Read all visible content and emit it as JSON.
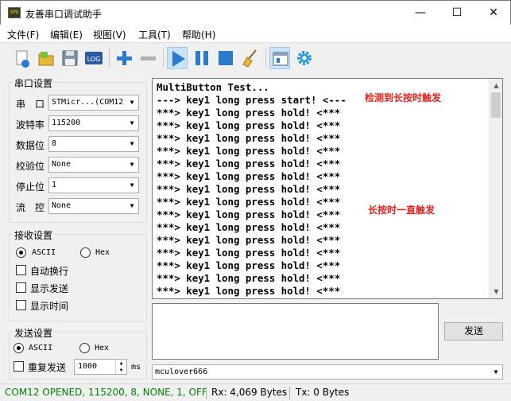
{
  "window": {
    "title": "友善串口调试助手",
    "icon_text": "SPU",
    "controls": {
      "minimize": "—",
      "maximize": "☐",
      "close": "✕"
    }
  },
  "menu": [
    "文件(F)",
    "编辑(E)",
    "视图(V)",
    "工具(T)",
    "帮助(H)"
  ],
  "toolbar": {
    "log_label": "LOG"
  },
  "serial": {
    "title": "串口设置",
    "fields": [
      {
        "label": "串　口",
        "value": "STMicr...(COM12"
      },
      {
        "label": "波特率",
        "value": "115200"
      },
      {
        "label": "数据位",
        "value": "8"
      },
      {
        "label": "校验位",
        "value": "None"
      },
      {
        "label": "停止位",
        "value": "1"
      },
      {
        "label": "流　控",
        "value": "None"
      }
    ]
  },
  "receive": {
    "title": "接收设置",
    "ascii": "ASCII",
    "hex": "Hex",
    "options": [
      "自动换行",
      "显示发送",
      "显示时间"
    ]
  },
  "send": {
    "title": "发送设置",
    "ascii": "ASCII",
    "hex": "Hex",
    "repeat_label": "重复发送",
    "interval": "1000",
    "unit": "ms",
    "button": "发送",
    "history": "mculover666"
  },
  "rx_lines": [
    "MultiButton Test...",
    "---> key1 long press start! <---",
    "***> key1 long press hold! <***",
    "***> key1 long press hold! <***",
    "***> key1 long press hold! <***",
    "***> key1 long press hold! <***",
    "***> key1 long press hold! <***",
    "***> key1 long press hold! <***",
    "***> key1 long press hold! <***",
    "***> key1 long press hold! <***",
    "***> key1 long press hold! <***",
    "***> key1 long press hold! <***",
    "***> key1 long press hold! <***",
    "***> key1 long press hold! <***",
    "***> key1 long press hold! <***",
    "***> key1 long press hold! <***",
    "***> key1 long press hold! <***"
  ],
  "annotations": {
    "start": "检测到长按时触发",
    "hold": "长按时一直触发",
    "color": "#e8231f"
  },
  "status": {
    "port": "COM12 OPENED, 115200, 8, NONE, 1, OFF",
    "rx": "Rx: 4,069 Bytes",
    "tx": "Tx: 0 Bytes",
    "port_color": "#008000"
  }
}
